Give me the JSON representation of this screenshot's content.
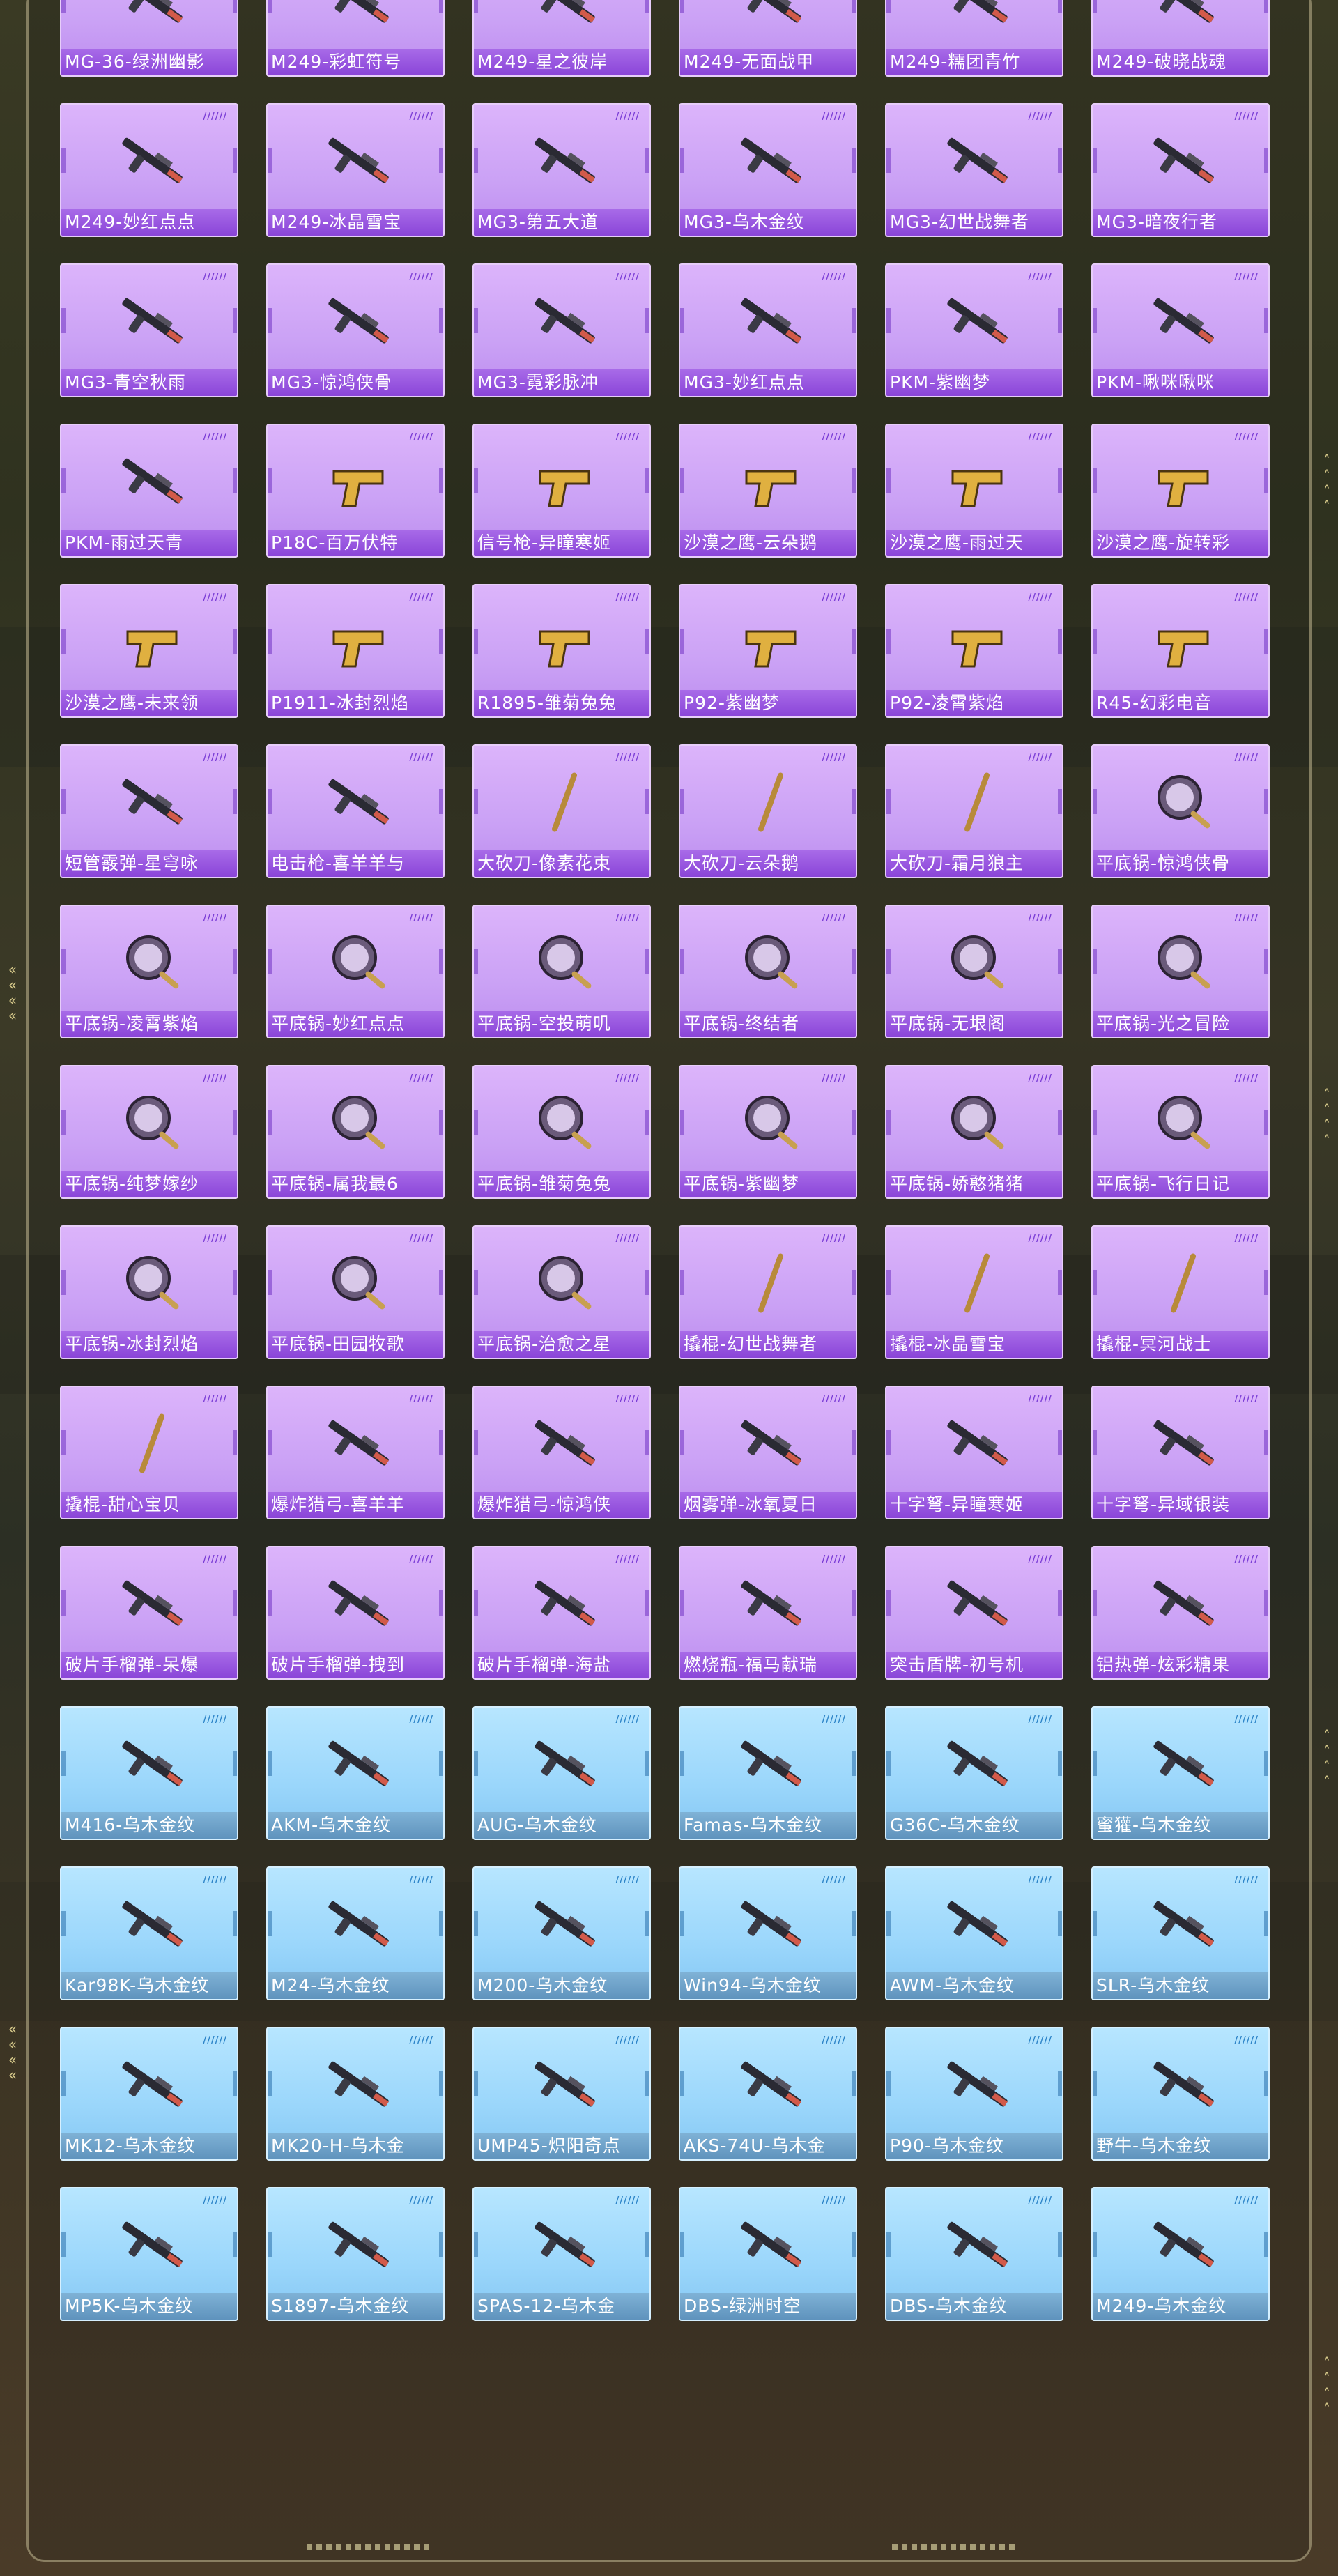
{
  "rank_marks": "//////",
  "rows": [
    [
      {
        "label": "MG-36-绿洲幽影",
        "tier": "purple"
      },
      {
        "label": "M249-彩虹符号",
        "tier": "purple"
      },
      {
        "label": "M249-星之彼岸",
        "tier": "purple"
      },
      {
        "label": "M249-无面战甲",
        "tier": "purple"
      },
      {
        "label": "M249-糯团青竹",
        "tier": "purple"
      },
      {
        "label": "M249-破晓战魂",
        "tier": "purple"
      }
    ],
    [
      {
        "label": "M249-妙红点点",
        "tier": "purple"
      },
      {
        "label": "M249-冰晶雪宝",
        "tier": "purple"
      },
      {
        "label": "MG3-第五大道",
        "tier": "purple"
      },
      {
        "label": "MG3-乌木金纹",
        "tier": "purple"
      },
      {
        "label": "MG3-幻世战舞者",
        "tier": "purple"
      },
      {
        "label": "MG3-暗夜行者",
        "tier": "purple"
      }
    ],
    [
      {
        "label": "MG3-青空秋雨",
        "tier": "purple"
      },
      {
        "label": "MG3-惊鸿侠骨",
        "tier": "purple"
      },
      {
        "label": "MG3-霓彩脉冲",
        "tier": "purple"
      },
      {
        "label": "MG3-妙红点点",
        "tier": "purple"
      },
      {
        "label": "PKM-紫幽梦",
        "tier": "purple"
      },
      {
        "label": "PKM-啾咪啾咪",
        "tier": "purple"
      }
    ],
    [
      {
        "label": "PKM-雨过天青",
        "tier": "purple"
      },
      {
        "label": "P18C-百万伏特",
        "tier": "purple"
      },
      {
        "label": "信号枪-异瞳寒姬",
        "tier": "purple"
      },
      {
        "label": "沙漠之鹰-云朵鹅",
        "tier": "purple"
      },
      {
        "label": "沙漠之鹰-雨过天",
        "tier": "purple"
      },
      {
        "label": "沙漠之鹰-旋转彩",
        "tier": "purple"
      }
    ],
    [
      {
        "label": "沙漠之鹰-未来领",
        "tier": "purple"
      },
      {
        "label": "P1911-冰封烈焰",
        "tier": "purple"
      },
      {
        "label": "R1895-雏菊兔兔",
        "tier": "purple"
      },
      {
        "label": "P92-紫幽梦",
        "tier": "purple"
      },
      {
        "label": "P92-凌霄紫焰",
        "tier": "purple"
      },
      {
        "label": "R45-幻彩电音",
        "tier": "purple"
      }
    ],
    [
      {
        "label": "短管霰弹-星穹咏",
        "tier": "purple"
      },
      {
        "label": "电击枪-喜羊羊与",
        "tier": "purple"
      },
      {
        "label": "大砍刀-像素花束",
        "tier": "purple"
      },
      {
        "label": "大砍刀-云朵鹅",
        "tier": "purple"
      },
      {
        "label": "大砍刀-霜月狼主",
        "tier": "purple"
      },
      {
        "label": "平底锅-惊鸿侠骨",
        "tier": "purple"
      }
    ],
    [
      {
        "label": "平底锅-凌霄紫焰",
        "tier": "purple"
      },
      {
        "label": "平底锅-妙红点点",
        "tier": "purple"
      },
      {
        "label": "平底锅-空投萌叽",
        "tier": "purple"
      },
      {
        "label": "平底锅-终结者",
        "tier": "purple"
      },
      {
        "label": "平底锅-无垠阁",
        "tier": "purple"
      },
      {
        "label": "平底锅-光之冒险",
        "tier": "purple"
      }
    ],
    [
      {
        "label": "平底锅-纯梦嫁纱",
        "tier": "purple"
      },
      {
        "label": "平底锅-属我最6",
        "tier": "purple"
      },
      {
        "label": "平底锅-雏菊兔兔",
        "tier": "purple"
      },
      {
        "label": "平底锅-紫幽梦",
        "tier": "purple"
      },
      {
        "label": "平底锅-娇憨猪猪",
        "tier": "purple"
      },
      {
        "label": "平底锅-飞行日记",
        "tier": "purple"
      }
    ],
    [
      {
        "label": "平底锅-冰封烈焰",
        "tier": "purple"
      },
      {
        "label": "平底锅-田园牧歌",
        "tier": "purple"
      },
      {
        "label": "平底锅-治愈之星",
        "tier": "purple"
      },
      {
        "label": "撬棍-幻世战舞者",
        "tier": "purple"
      },
      {
        "label": "撬棍-冰晶雪宝",
        "tier": "purple"
      },
      {
        "label": "撬棍-冥河战士",
        "tier": "purple"
      }
    ],
    [
      {
        "label": "撬棍-甜心宝贝",
        "tier": "purple"
      },
      {
        "label": "爆炸猎弓-喜羊羊",
        "tier": "purple"
      },
      {
        "label": "爆炸猎弓-惊鸿侠",
        "tier": "purple"
      },
      {
        "label": "烟雾弹-冰氧夏日",
        "tier": "purple"
      },
      {
        "label": "十字弩-异瞳寒姬",
        "tier": "purple"
      },
      {
        "label": "十字弩-异域银装",
        "tier": "purple"
      }
    ],
    [
      {
        "label": "破片手榴弹-呆爆",
        "tier": "purple"
      },
      {
        "label": "破片手榴弹-拽到",
        "tier": "purple"
      },
      {
        "label": "破片手榴弹-海盐",
        "tier": "purple"
      },
      {
        "label": "燃烧瓶-福马献瑞",
        "tier": "purple"
      },
      {
        "label": "突击盾牌-初号机",
        "tier": "purple"
      },
      {
        "label": "铝热弹-炫彩糖果",
        "tier": "purple"
      }
    ],
    [
      {
        "label": "M416-乌木金纹",
        "tier": "blue"
      },
      {
        "label": "AKM-乌木金纹",
        "tier": "blue"
      },
      {
        "label": "AUG-乌木金纹",
        "tier": "blue"
      },
      {
        "label": "Famas-乌木金纹",
        "tier": "blue"
      },
      {
        "label": "G36C-乌木金纹",
        "tier": "blue"
      },
      {
        "label": "蜜獾-乌木金纹",
        "tier": "blue"
      }
    ],
    [
      {
        "label": "Kar98K-乌木金纹",
        "tier": "blue"
      },
      {
        "label": "M24-乌木金纹",
        "tier": "blue"
      },
      {
        "label": "M200-乌木金纹",
        "tier": "blue"
      },
      {
        "label": "Win94-乌木金纹",
        "tier": "blue"
      },
      {
        "label": "AWM-乌木金纹",
        "tier": "blue"
      },
      {
        "label": "SLR-乌木金纹",
        "tier": "blue"
      }
    ],
    [
      {
        "label": "MK12-乌木金纹",
        "tier": "blue"
      },
      {
        "label": "MK20-H-乌木金",
        "tier": "blue"
      },
      {
        "label": "UMP45-炽阳奇点",
        "tier": "blue"
      },
      {
        "label": "AKS-74U-乌木金",
        "tier": "blue"
      },
      {
        "label": "P90-乌木金纹",
        "tier": "blue"
      },
      {
        "label": "野牛-乌木金纹",
        "tier": "blue"
      }
    ],
    [
      {
        "label": "MP5K-乌木金纹",
        "tier": "blue"
      },
      {
        "label": "S1897-乌木金纹",
        "tier": "blue"
      },
      {
        "label": "SPAS-12-乌木金",
        "tier": "blue"
      },
      {
        "label": "DBS-绿洲时空",
        "tier": "blue"
      },
      {
        "label": "DBS-乌木金纹",
        "tier": "blue"
      },
      {
        "label": "M249-乌木金纹",
        "tier": "blue"
      }
    ]
  ]
}
